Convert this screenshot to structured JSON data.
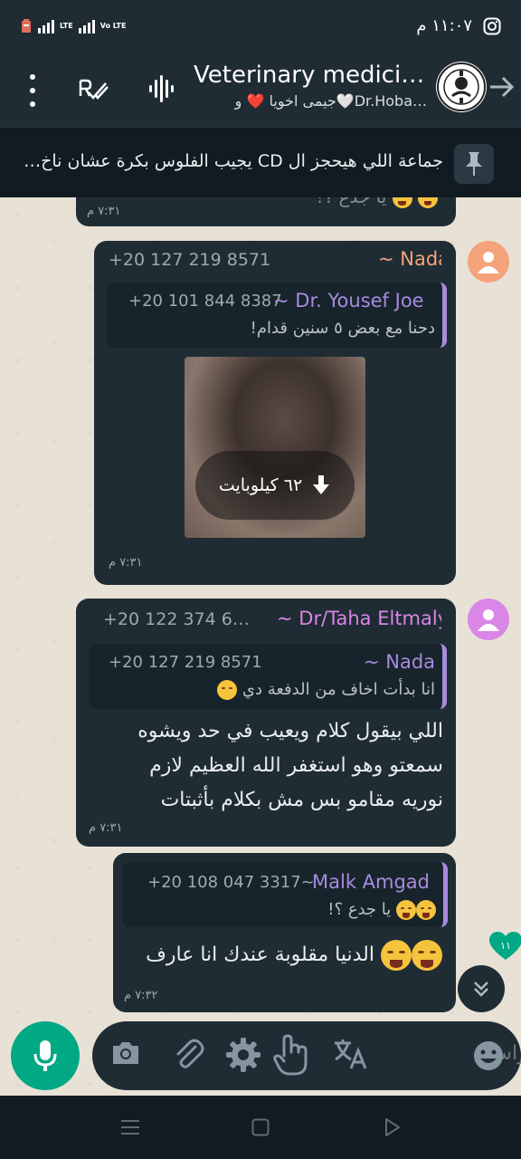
{
  "status_bar": {
    "time": "١١:٠٧ م",
    "network_labels": [
      "LTE",
      "Vo LTE"
    ]
  },
  "header": {
    "title": "Veterinary medici…",
    "subtitle": "جيمى اخويا ❤️ و🤍Dr.Hoba…",
    "icons": [
      "more-vert-icon",
      "read-check-icon",
      "voice-wave-icon",
      "back-arrow-icon"
    ]
  },
  "pinned": {
    "text": "جماعة اللي هيحجز ال CD يجيب الفلوس بكرة عشان ناخ…"
  },
  "messages": [
    {
      "id": "partial",
      "time": "٧:٣١ م",
      "partial_text": "يا جدع ؟!"
    },
    {
      "id": "nada_media",
      "sender_name": "~ Nada",
      "sender_phone": "+20 127 219 8571",
      "sender_color": "#f4a37a",
      "quote": {
        "name": "~ Dr. Yousef Joe",
        "phone": "+20 101 844 8387",
        "text": "دحنا مع بعض ٥ سنين قدام!"
      },
      "media": {
        "download_label": "٦٢ كيلوبايت"
      },
      "time": "٧:٣١ م"
    },
    {
      "id": "taha",
      "sender_name": "~ Dr/Taha Eltmaly",
      "sender_phone": "+20 122 374 6…",
      "sender_color": "#d986e6",
      "quote": {
        "name": "~ Nada",
        "phone": "+20 127 219 8571",
        "text": "انا بدأت اخاف من الدفعة دي"
      },
      "text_lines": [
        "اللي بيقول كلام ويعيب في حد ويشوه",
        "سمعتو وهو استغفر الله العظيم لازم",
        "نوريه مقامو بس مش بكلام بأثبتات"
      ],
      "time": "٧:٣١ م"
    },
    {
      "id": "self",
      "quote": {
        "name": "Malk Amgad",
        "phone": "+20 108 047 3317~",
        "text": "يا جدع ؟!"
      },
      "text": "الدنيا مقلوبة عندك انا عارف",
      "time": "٧:٣٢ م"
    }
  ],
  "unread_badge": "١١",
  "input": {
    "placeholder": "مراس..",
    "icons": [
      "camera-icon",
      "attach-icon",
      "settings-icon",
      "touch-icon",
      "translate-icon",
      "emoji-icon"
    ]
  },
  "colors": {
    "accent": "#00a884",
    "bubble": "#1f2c34",
    "header": "#1f2c34",
    "quote_bar": "#a78bde"
  }
}
